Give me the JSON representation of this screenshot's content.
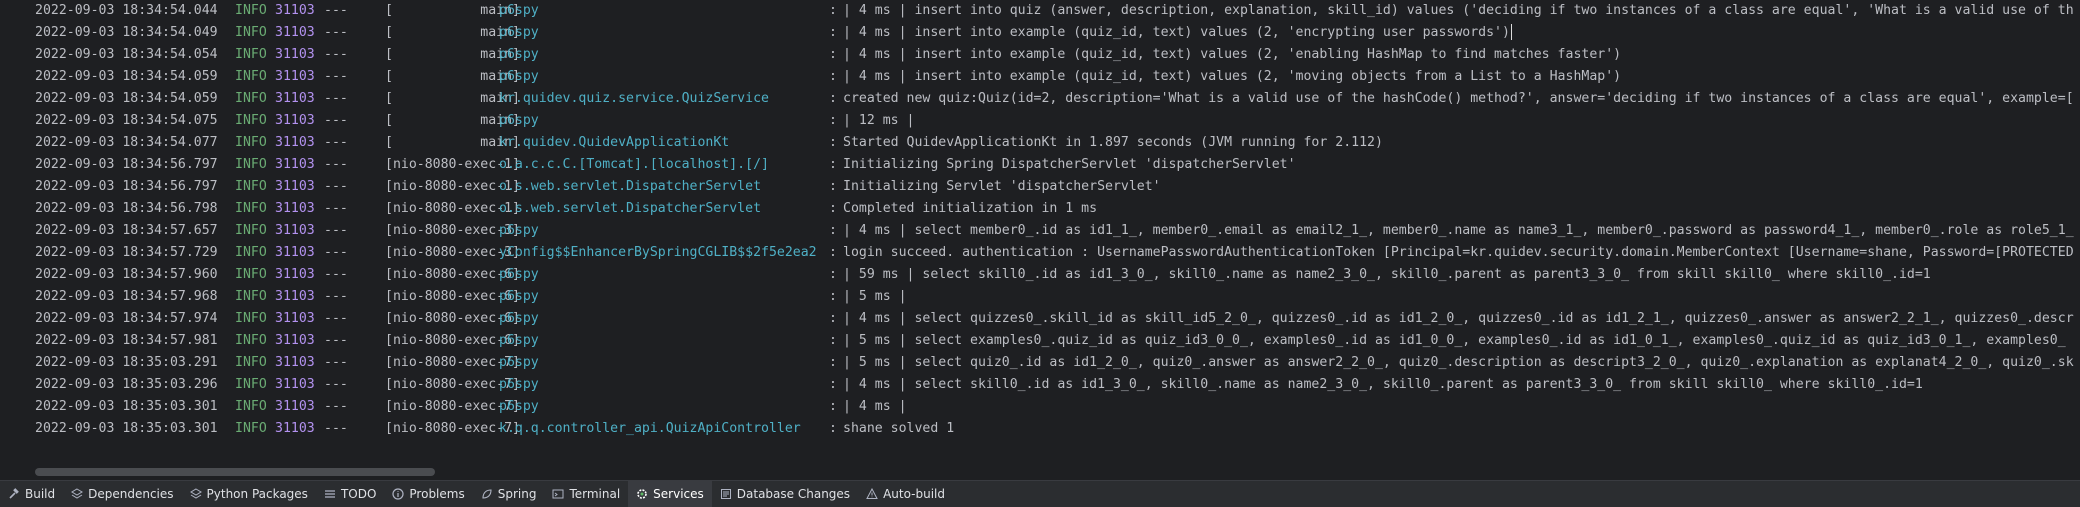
{
  "console": {
    "lines": [
      {
        "ts": "2022-09-03 18:34:54.044",
        "level": "INFO",
        "pid": "31103",
        "sep": "---",
        "thread": "[           main]",
        "logger": "p6spy",
        "colon": ":",
        "message": "| 4 ms | insert into quiz (answer, description, explanation, skill_id) values ('deciding if two instances of a class are equal', 'What is a valid use of th"
      },
      {
        "ts": "2022-09-03 18:34:54.049",
        "level": "INFO",
        "pid": "31103",
        "sep": "---",
        "thread": "[           main]",
        "logger": "p6spy",
        "colon": ":",
        "message": "| 4 ms | insert into example (quiz_id, text) values (2, 'encrypting user passwords')"
      },
      {
        "ts": "2022-09-03 18:34:54.054",
        "level": "INFO",
        "pid": "31103",
        "sep": "---",
        "thread": "[           main]",
        "logger": "p6spy",
        "colon": ":",
        "message": "| 4 ms | insert into example (quiz_id, text) values (2, 'enabling HashMap to find matches faster')"
      },
      {
        "ts": "2022-09-03 18:34:54.059",
        "level": "INFO",
        "pid": "31103",
        "sep": "---",
        "thread": "[           main]",
        "logger": "p6spy",
        "colon": ":",
        "message": "| 4 ms | insert into example (quiz_id, text) values (2, 'moving objects from a List to a HashMap')"
      },
      {
        "ts": "2022-09-03 18:34:54.059",
        "level": "INFO",
        "pid": "31103",
        "sep": "---",
        "thread": "[           main]",
        "logger": "kr.quidev.quiz.service.QuizService",
        "colon": ":",
        "message": "created new quiz:Quiz(id=2, description='What is a valid use of the hashCode() method?', answer='deciding if two instances of a class are equal', example=["
      },
      {
        "ts": "2022-09-03 18:34:54.075",
        "level": "INFO",
        "pid": "31103",
        "sep": "---",
        "thread": "[           main]",
        "logger": "p6spy",
        "colon": ":",
        "message": "| 12 ms |"
      },
      {
        "ts": "2022-09-03 18:34:54.077",
        "level": "INFO",
        "pid": "31103",
        "sep": "---",
        "thread": "[           main]",
        "logger": "kr.quidev.QuidevApplicationKt",
        "colon": ":",
        "message": "Started QuidevApplicationKt in 1.897 seconds (JVM running for 2.112)"
      },
      {
        "ts": "2022-09-03 18:34:56.797",
        "level": "INFO",
        "pid": "31103",
        "sep": "---",
        "thread": "[nio-8080-exec-1]",
        "logger": "o.a.c.c.C.[Tomcat].[localhost].[/]",
        "colon": ":",
        "message": "Initializing Spring DispatcherServlet 'dispatcherServlet'"
      },
      {
        "ts": "2022-09-03 18:34:56.797",
        "level": "INFO",
        "pid": "31103",
        "sep": "---",
        "thread": "[nio-8080-exec-1]",
        "logger": "o.s.web.servlet.DispatcherServlet",
        "colon": ":",
        "message": "Initializing Servlet 'dispatcherServlet'"
      },
      {
        "ts": "2022-09-03 18:34:56.798",
        "level": "INFO",
        "pid": "31103",
        "sep": "---",
        "thread": "[nio-8080-exec-1]",
        "logger": "o.s.web.servlet.DispatcherServlet",
        "colon": ":",
        "message": "Completed initialization in 1 ms"
      },
      {
        "ts": "2022-09-03 18:34:57.657",
        "level": "INFO",
        "pid": "31103",
        "sep": "---",
        "thread": "[nio-8080-exec-3]",
        "logger": "p6spy",
        "colon": ":",
        "message": "| 4 ms | select member0_.id as id1_1_, member0_.email as email2_1_, member0_.name as name3_1_, member0_.password as password4_1_, member0_.role as role5_1_"
      },
      {
        "ts": "2022-09-03 18:34:57.729",
        "level": "INFO",
        "pid": "31103",
        "sep": "---",
        "thread": "[nio-8080-exec-3]",
        "logger": "yConfig$$EnhancerBySpringCGLIB$$2f5e2ea2",
        "colon": ":",
        "message": "login succeed. authentication : UsernamePasswordAuthenticationToken [Principal=kr.quidev.security.domain.MemberContext [Username=shane, Password=[PROTECTED"
      },
      {
        "ts": "2022-09-03 18:34:57.960",
        "level": "INFO",
        "pid": "31103",
        "sep": "---",
        "thread": "[nio-8080-exec-6]",
        "logger": "p6spy",
        "colon": ":",
        "message": "| 59 ms | select skill0_.id as id1_3_0_, skill0_.name as name2_3_0_, skill0_.parent as parent3_3_0_ from skill skill0_ where skill0_.id=1"
      },
      {
        "ts": "2022-09-03 18:34:57.968",
        "level": "INFO",
        "pid": "31103",
        "sep": "---",
        "thread": "[nio-8080-exec-6]",
        "logger": "p6spy",
        "colon": ":",
        "message": "| 5 ms |"
      },
      {
        "ts": "2022-09-03 18:34:57.974",
        "level": "INFO",
        "pid": "31103",
        "sep": "---",
        "thread": "[nio-8080-exec-6]",
        "logger": "p6spy",
        "colon": ":",
        "message": "| 4 ms | select quizzes0_.skill_id as skill_id5_2_0_, quizzes0_.id as id1_2_0_, quizzes0_.id as id1_2_1_, quizzes0_.answer as answer2_2_1_, quizzes0_.descr"
      },
      {
        "ts": "2022-09-03 18:34:57.981",
        "level": "INFO",
        "pid": "31103",
        "sep": "---",
        "thread": "[nio-8080-exec-6]",
        "logger": "p6spy",
        "colon": ":",
        "message": "| 5 ms | select examples0_.quiz_id as quiz_id3_0_0_, examples0_.id as id1_0_0_, examples0_.id as id1_0_1_, examples0_.quiz_id as quiz_id3_0_1_, examples0_"
      },
      {
        "ts": "2022-09-03 18:35:03.291",
        "level": "INFO",
        "pid": "31103",
        "sep": "---",
        "thread": "[nio-8080-exec-7]",
        "logger": "p6spy",
        "colon": ":",
        "message": "| 5 ms | select quiz0_.id as id1_2_0_, quiz0_.answer as answer2_2_0_, quiz0_.description as descript3_2_0_, quiz0_.explanation as explanat4_2_0_, quiz0_.sk"
      },
      {
        "ts": "2022-09-03 18:35:03.296",
        "level": "INFO",
        "pid": "31103",
        "sep": "---",
        "thread": "[nio-8080-exec-7]",
        "logger": "p6spy",
        "colon": ":",
        "message": "| 4 ms | select skill0_.id as id1_3_0_, skill0_.name as name2_3_0_, skill0_.parent as parent3_3_0_ from skill skill0_ where skill0_.id=1"
      },
      {
        "ts": "2022-09-03 18:35:03.301",
        "level": "INFO",
        "pid": "31103",
        "sep": "---",
        "thread": "[nio-8080-exec-7]",
        "logger": "p6spy",
        "colon": ":",
        "message": "| 4 ms |"
      },
      {
        "ts": "2022-09-03 18:35:03.301",
        "level": "INFO",
        "pid": "31103",
        "sep": "---",
        "thread": "[nio-8080-exec-7]",
        "logger": "k.q.q.controller_api.QuizApiController",
        "colon": ":",
        "message": "shane solved 1"
      }
    ]
  },
  "toolbar": {
    "items": [
      {
        "label": "Build",
        "icon": "hammer-icon",
        "active": false
      },
      {
        "label": "Dependencies",
        "icon": "layers-icon",
        "active": false
      },
      {
        "label": "Python Packages",
        "icon": "layers-icon",
        "active": false
      },
      {
        "label": "TODO",
        "icon": "list-icon",
        "active": false
      },
      {
        "label": "Problems",
        "icon": "info-circle-icon",
        "active": false
      },
      {
        "label": "Spring",
        "icon": "spring-leaf-icon",
        "active": false
      },
      {
        "label": "Terminal",
        "icon": "terminal-icon",
        "active": false
      },
      {
        "label": "Services",
        "icon": "services-gear-icon",
        "active": true
      },
      {
        "label": "Database Changes",
        "icon": "database-changes-icon",
        "active": false
      },
      {
        "label": "Auto-build",
        "icon": "warning-triangle-icon",
        "active": false
      }
    ]
  },
  "colors": {
    "background": "#1e1f22",
    "info_level": "#6aab73",
    "pid": "#b392f0",
    "logger": "#4fb0c6",
    "text": "#bcbec4",
    "toolbar_bg": "#2b2d30",
    "active_tool_bg": "#393b40"
  }
}
